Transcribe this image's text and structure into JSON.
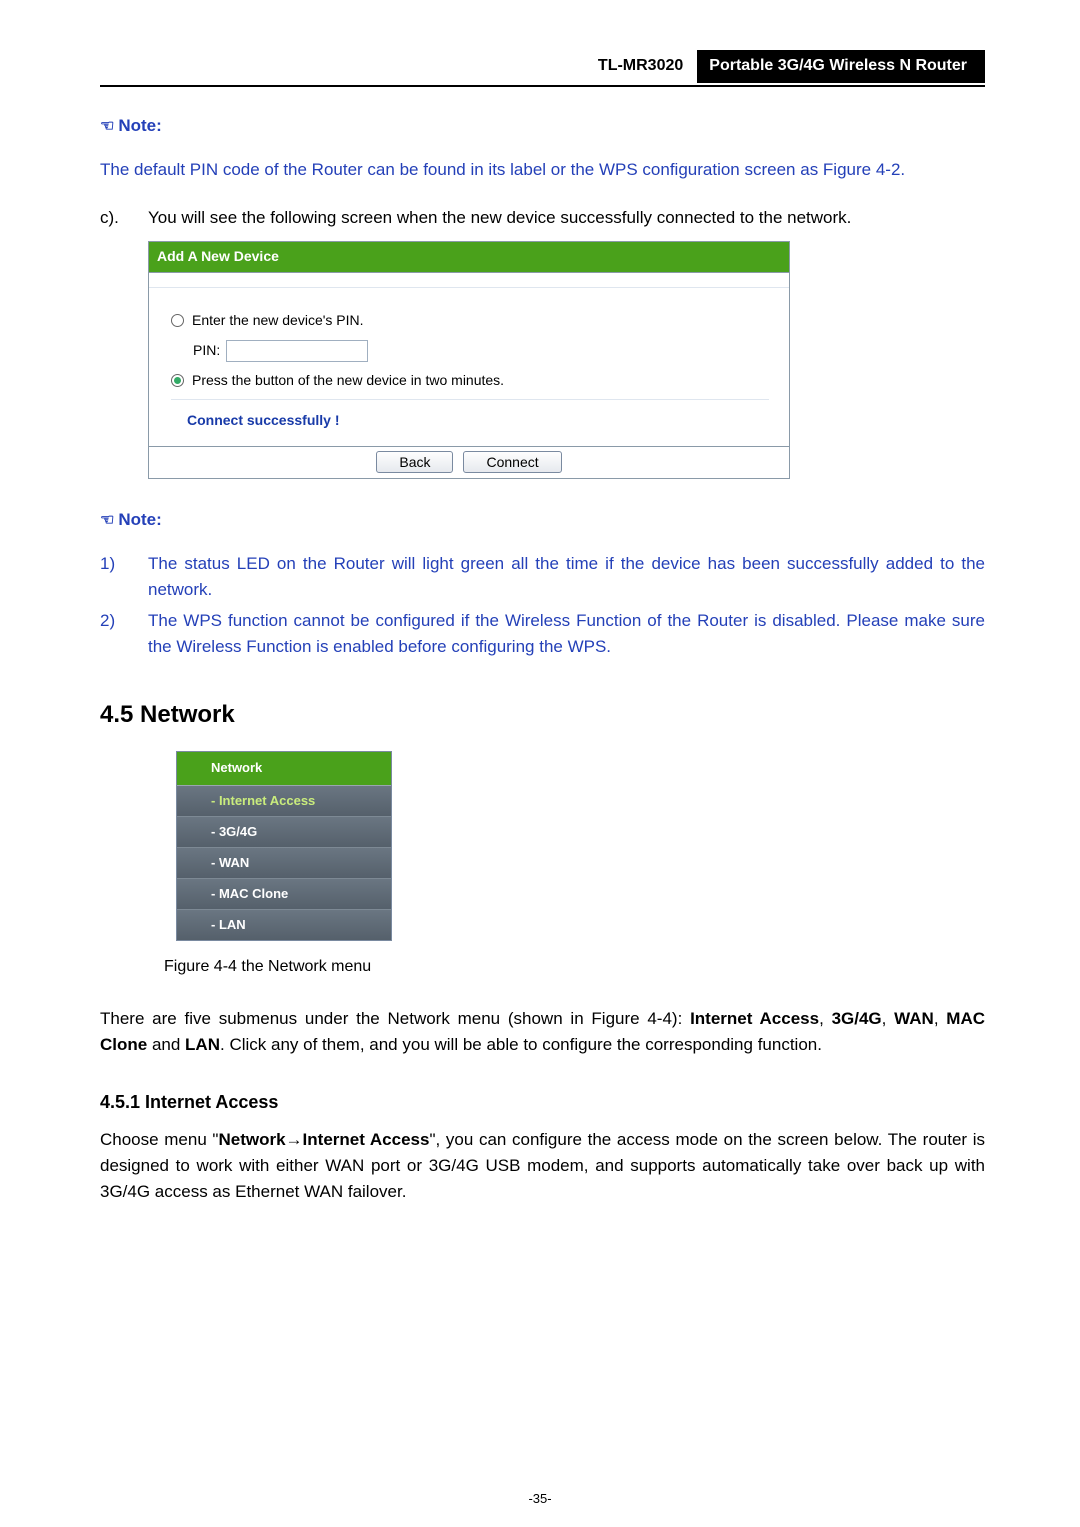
{
  "header": {
    "model": "TL-MR3020",
    "subtitle": "Portable 3G/4G Wireless N Router"
  },
  "note1": {
    "prefix": "Note:",
    "body_a": "The default PIN code of the Router can be found in its label or the WPS configuration screen as ",
    "body_b": "Figure 4-2",
    "body_c": "."
  },
  "item_c": {
    "label": "c).",
    "text": "You will see the following screen when the new device successfully connected to the network."
  },
  "device_box": {
    "title": "Add A New Device",
    "radio_pin_label": "Enter the new device's PIN.",
    "pin_label": "PIN:",
    "pin_value": "",
    "radio_press_label": "Press the button of the new device in two minutes.",
    "success": "Connect successfully !",
    "btn_back": "Back",
    "btn_connect": "Connect"
  },
  "note2": {
    "prefix": "Note:",
    "items": [
      {
        "num": "1)",
        "text": "The status LED on the Router will light green all the time if the device has been successfully added to the network."
      },
      {
        "num": "2)",
        "text": "The WPS function cannot be configured if the Wireless Function of the Router is disabled. Please make sure the Wireless Function is enabled before configuring the WPS."
      }
    ]
  },
  "section_heading": "4.5  Network",
  "network_menu": {
    "header": "Network",
    "items": [
      {
        "label": "- Internet Access",
        "active": true
      },
      {
        "label": "- 3G/4G",
        "active": false
      },
      {
        "label": "- WAN",
        "active": false
      },
      {
        "label": "- MAC Clone",
        "active": false
      },
      {
        "label": "- LAN",
        "active": false
      }
    ]
  },
  "figure_caption": "Figure 4-4    the Network menu",
  "para_submenus": {
    "a": "There are five submenus under the Network menu (shown in ",
    "fig": "Figure 4-4",
    "b": "): ",
    "m1": "Internet Access",
    "c": ", ",
    "m2": "3G/4G",
    "d": ", ",
    "m3": "WAN",
    "e": ", ",
    "m4": "MAC Clone",
    "f": " and ",
    "m5": "LAN",
    "g": ". Click any of them, and you will be able to configure the corresponding function."
  },
  "subsection_heading": "4.5.1    Internet Access",
  "para_access": {
    "a": "Choose menu \"",
    "b": "Network",
    "arrow": "→",
    "c": "Internet Access",
    "d": "\", you can configure the access mode on the screen below. The router is designed to work with either WAN port or 3G/4G USB modem, and supports automatically take over back up with 3G/4G access as Ethernet WAN failover."
  },
  "page_number": "-35-"
}
